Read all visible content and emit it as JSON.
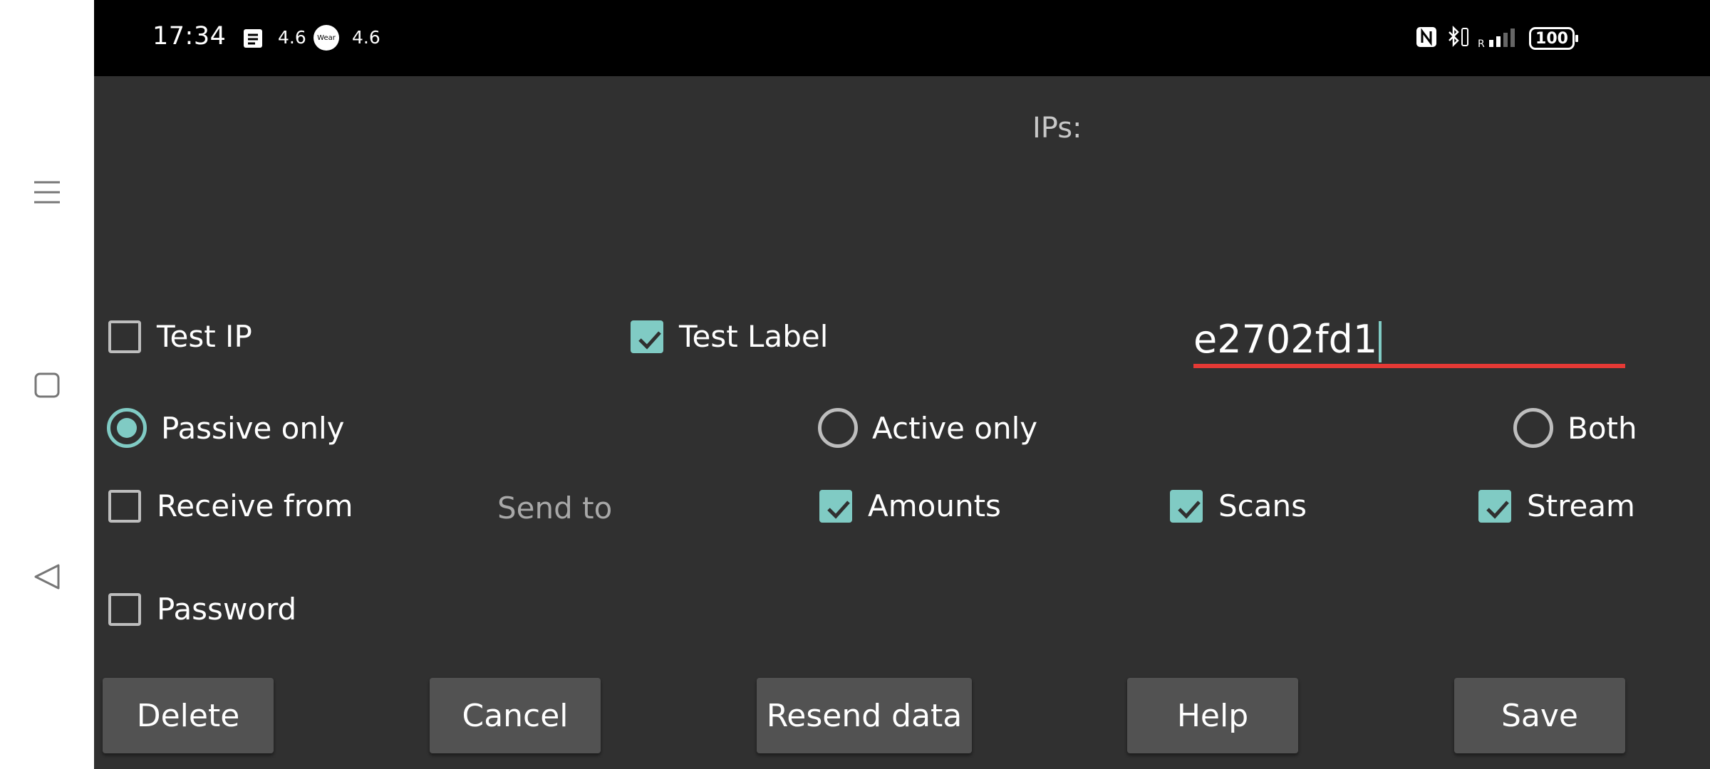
{
  "status_bar": {
    "time": "17:34",
    "speed1": "4.6",
    "wear_badge": "Wear",
    "speed2": "4.6",
    "battery": "100",
    "icons": [
      "notification-icon",
      "wear-icon",
      "nfc-icon",
      "bluetooth-icon",
      "signal-icon",
      "battery-icon"
    ]
  },
  "nav": {
    "items": [
      "menu-icon",
      "home-square-icon",
      "back-triangle-icon"
    ]
  },
  "form": {
    "ips_label": "IPs:",
    "test_ip": {
      "label": "Test IP",
      "checked": false
    },
    "test_label": {
      "label": "Test Label",
      "checked": true
    },
    "label_input": {
      "value": "e2702fd1"
    },
    "mode": {
      "options": [
        {
          "label": "Passive only",
          "selected": true
        },
        {
          "label": "Active only",
          "selected": false
        },
        {
          "label": "Both",
          "selected": false
        }
      ]
    },
    "receive_from": {
      "label": "Receive from",
      "checked": false
    },
    "send_to_label": "Send to",
    "amounts": {
      "label": "Amounts",
      "checked": true
    },
    "scans": {
      "label": "Scans",
      "checked": true
    },
    "stream": {
      "label": "Stream",
      "checked": true
    },
    "password": {
      "label": "Password",
      "checked": false
    }
  },
  "buttons": {
    "delete": "Delete",
    "cancel": "Cancel",
    "resend": "Resend data",
    "help": "Help",
    "save": "Save"
  },
  "colors": {
    "accent": "#80cbc4",
    "background": "#303030",
    "button": "#525252",
    "input_underline": "#e53935"
  }
}
